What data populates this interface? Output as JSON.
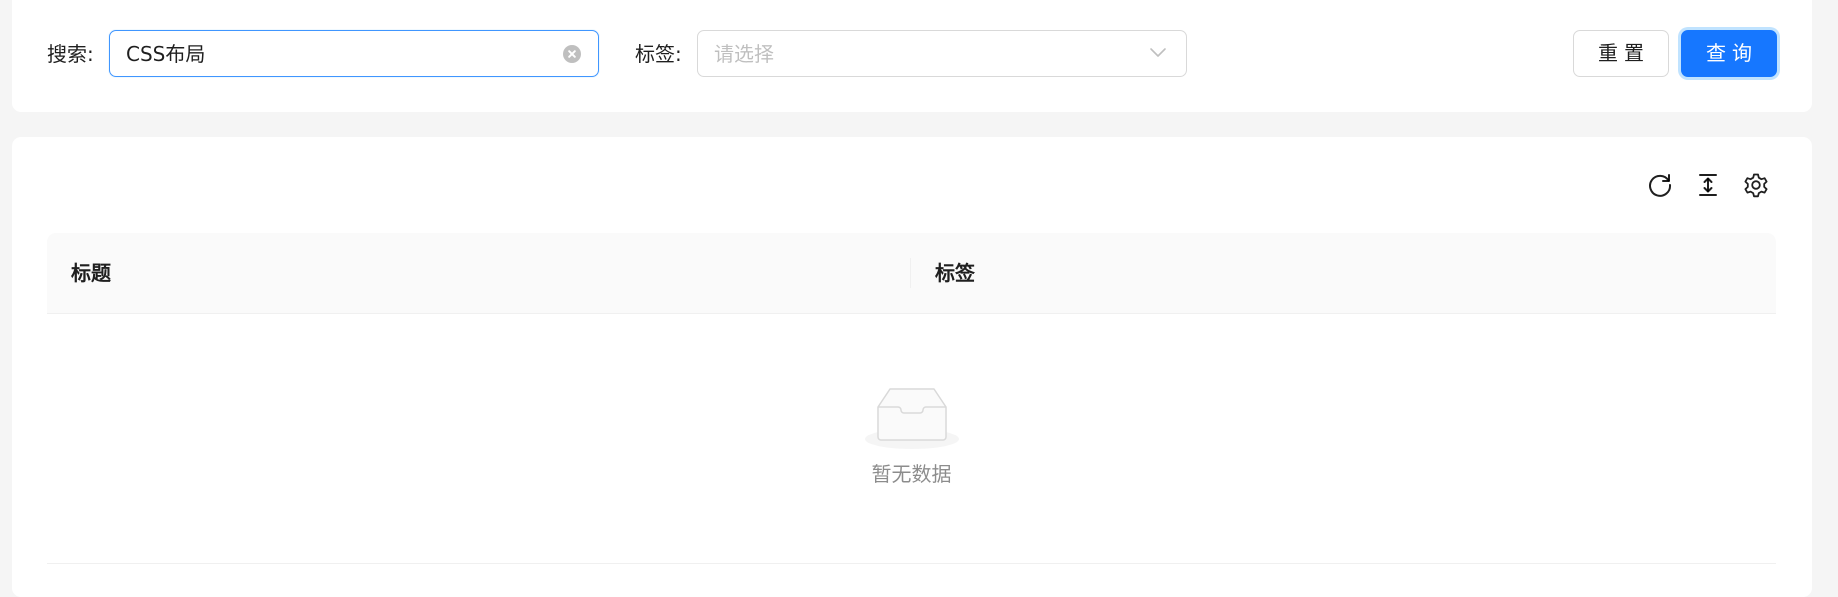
{
  "search_form": {
    "search_label": "搜索:",
    "search_value": "CSS布局",
    "tag_label": "标签:",
    "tag_placeholder": "请选择",
    "reset_label": "重置",
    "query_label": "查询"
  },
  "table": {
    "columns": [
      "标题",
      "标签"
    ],
    "rows": [],
    "empty_text": "暂无数据"
  },
  "toolbar": {
    "icons": [
      "reload-icon",
      "column-height-icon",
      "setting-icon"
    ]
  },
  "colors": {
    "primary": "#1677ff",
    "focus_border": "#4096ff",
    "page_bg": "#f5f5f5",
    "card_bg": "#ffffff",
    "header_bg": "#fafafa"
  }
}
